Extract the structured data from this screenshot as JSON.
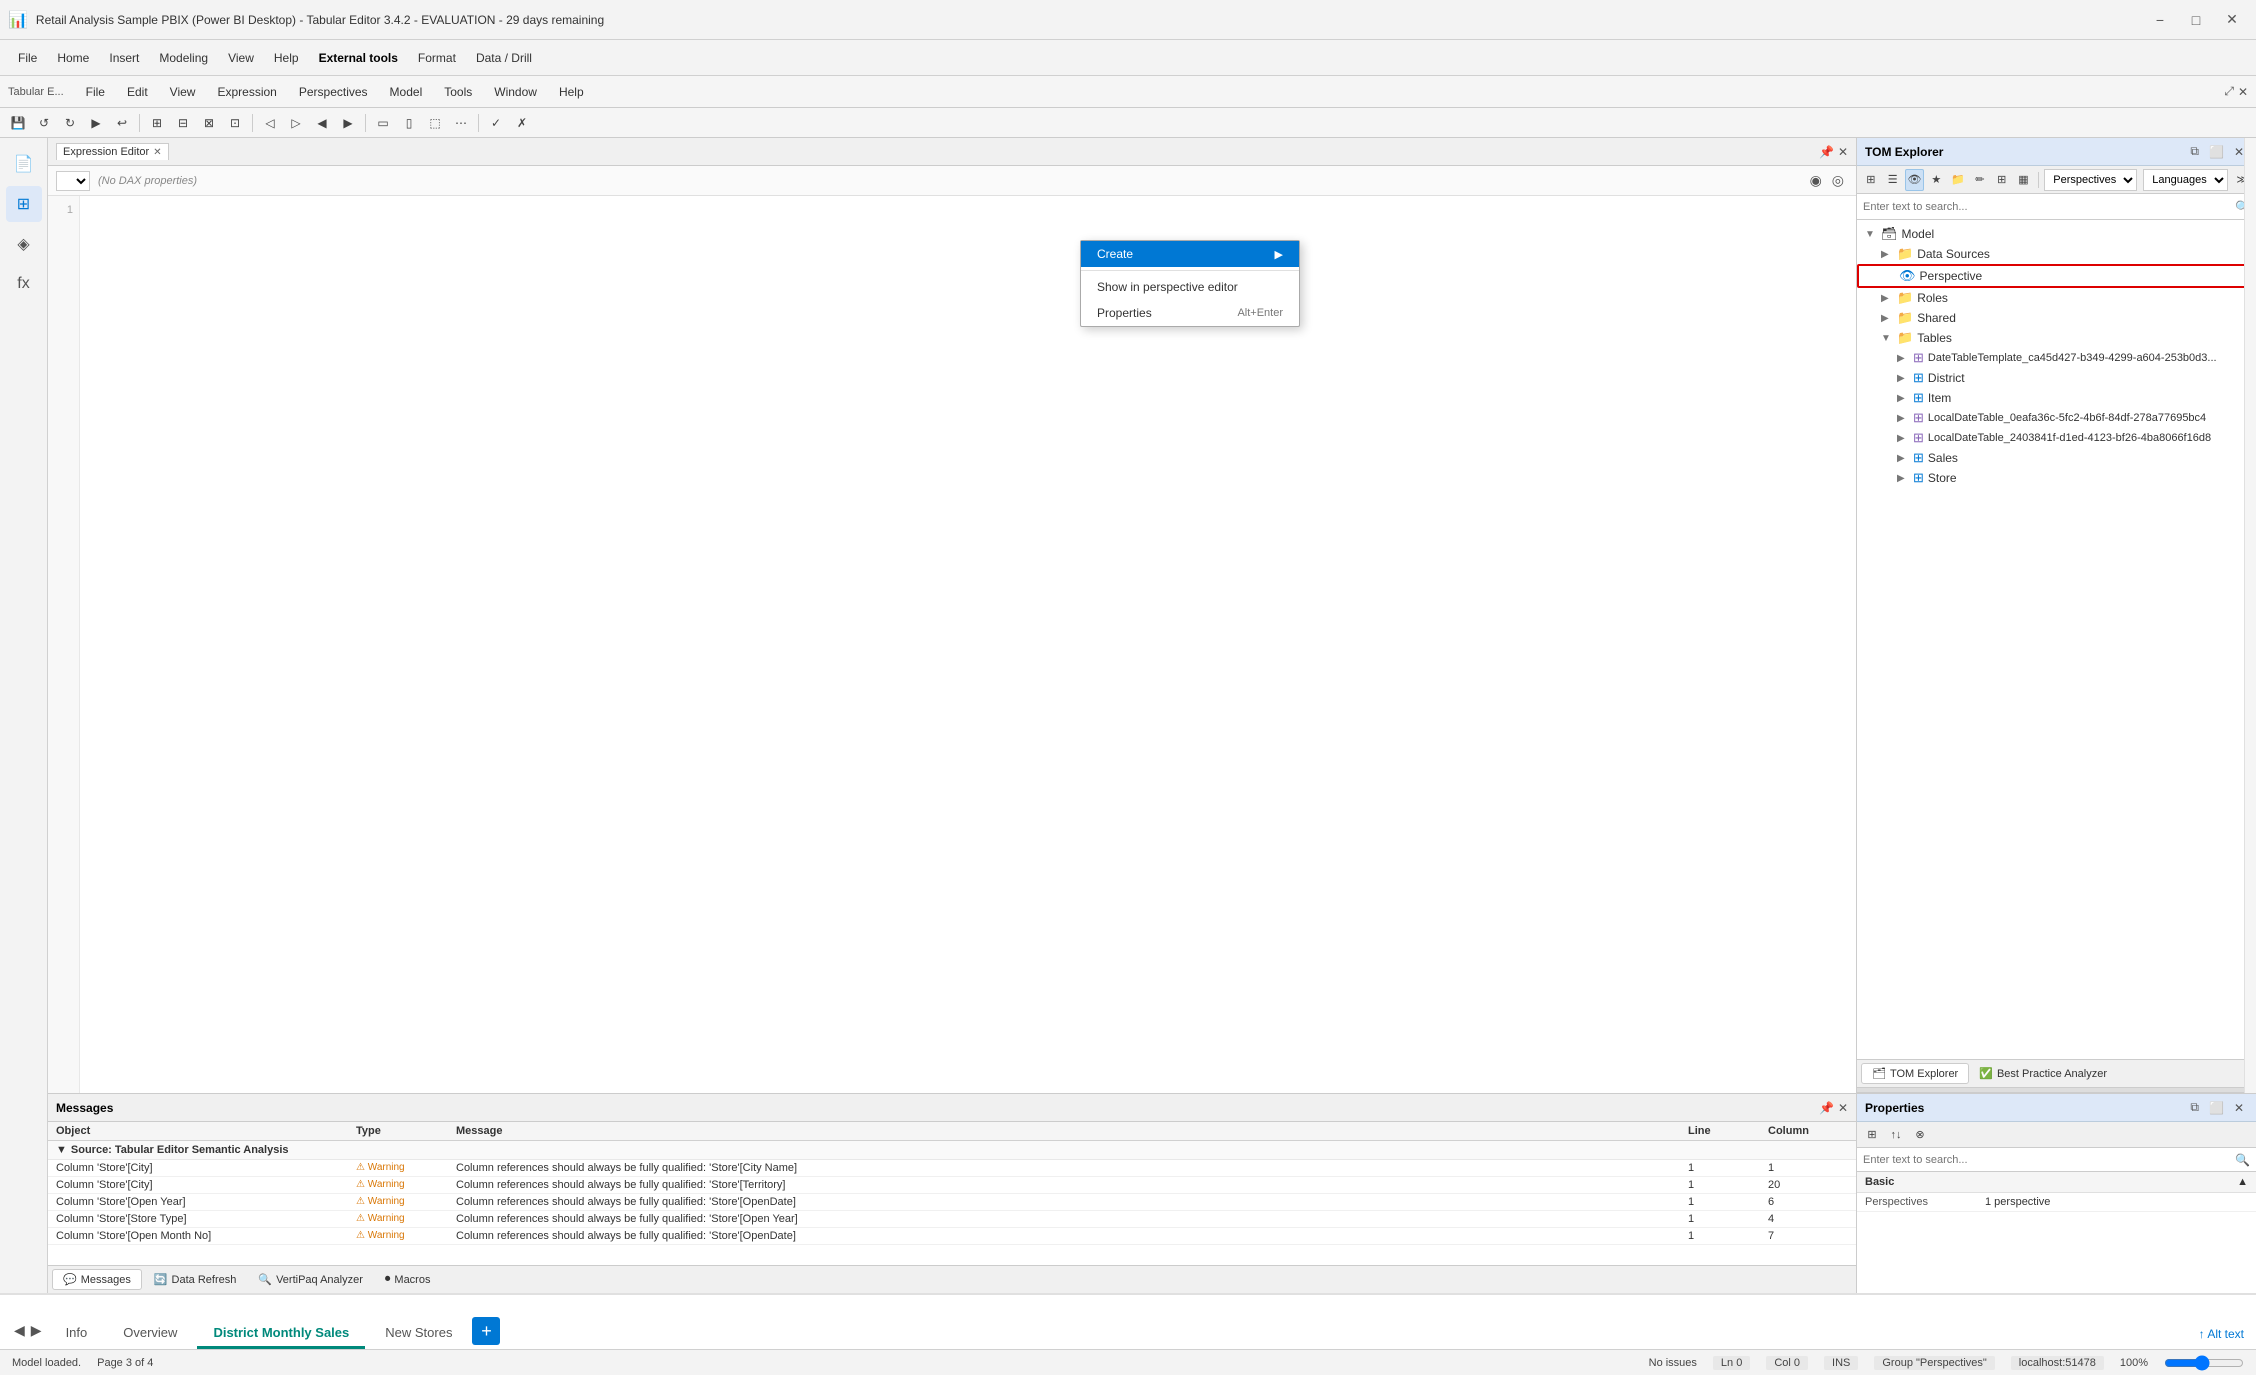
{
  "app": {
    "title": "Retail Analysis Sample PBIX (Power BI Desktop) - Tabular Editor 3.4.2 - EVALUATION - 29 days remaining",
    "icon": "📊"
  },
  "pbi_menu": {
    "items": [
      "File",
      "Home",
      "Insert",
      "Modeling",
      "View",
      "Help",
      "External tools",
      "Format",
      "Data / Drill"
    ]
  },
  "te_menu": {
    "items": [
      "File",
      "Edit",
      "View",
      "Expression",
      "Perspectives",
      "Model",
      "Tools",
      "Window",
      "Help"
    ]
  },
  "expression_editor": {
    "tab_label": "Expression Editor",
    "dax_selector_placeholder": "(No DAX properties)",
    "dax_dropdown_label": ""
  },
  "tom_explorer": {
    "title": "TOM Explorer",
    "search_placeholder": "Enter text to search...",
    "dropdown1": "Perspectives",
    "dropdown2": "Languages",
    "tree": {
      "model_label": "Model",
      "items": [
        {
          "level": 1,
          "label": "Data Sources",
          "icon": "folder",
          "expanded": false
        },
        {
          "level": 1,
          "label": "Roles",
          "icon": "folder",
          "expanded": false
        },
        {
          "level": 1,
          "label": "Shared",
          "icon": "folder",
          "expanded": false
        },
        {
          "level": 1,
          "label": "Tables",
          "icon": "folder",
          "expanded": true,
          "children": [
            {
              "label": "DateTableTemplate_ca45d427-b349-4299-a604-253b0d3...",
              "icon": "table-special"
            },
            {
              "label": "District",
              "icon": "table"
            },
            {
              "label": "Item",
              "icon": "table"
            },
            {
              "label": "LocalDateTable_0eafa36c-5fc2-4b6f-84df-278a77695bc4",
              "icon": "table-special"
            },
            {
              "label": "LocalDateTable_2403841f-d1ed-4123-bf26-4ba8066f16d8",
              "icon": "table-special"
            },
            {
              "label": "Sales",
              "icon": "table"
            },
            {
              "label": "Store",
              "icon": "table"
            }
          ]
        }
      ]
    },
    "tabs": [
      {
        "label": "TOM Explorer",
        "icon": "🗂"
      },
      {
        "label": "Best Practice Analyzer",
        "icon": "✓"
      }
    ]
  },
  "properties": {
    "title": "Properties",
    "search_placeholder": "Enter text to search...",
    "sections": [
      {
        "label": "Basic",
        "rows": [
          {
            "label": "Perspectives",
            "value": "1 perspective"
          }
        ]
      }
    ]
  },
  "messages": {
    "title": "Messages",
    "columns": [
      "Object",
      "Type",
      "Message",
      "Line",
      "Column"
    ],
    "group_label": "Source: Tabular Editor Semantic Analysis",
    "rows": [
      {
        "object": "Column 'Store'[City]",
        "type": "Warning",
        "message": "Column references should always be fully qualified: 'Store'[City Name]",
        "line": "1",
        "col": "1"
      },
      {
        "object": "Column 'Store'[City]",
        "type": "Warning",
        "message": "Column references should always be fully qualified: 'Store'[Territory]",
        "line": "1",
        "col": "20"
      },
      {
        "object": "Column 'Store'[Open Year]",
        "type": "Warning",
        "message": "Column references should always be fully qualified: 'Store'[OpenDate]",
        "line": "1",
        "col": "6"
      },
      {
        "object": "Column 'Store'[Store Type]",
        "type": "Warning",
        "message": "Column references should always be fully qualified: 'Store'[Open Year]",
        "line": "1",
        "col": "4"
      },
      {
        "object": "Column 'Store'[Open Month No]",
        "type": "Warning",
        "message": "Column references should always be fully qualified: 'Store'[OpenDate]",
        "line": "1",
        "col": "7"
      }
    ]
  },
  "bottom_tabs": {
    "nav_prev": "◀",
    "nav_next": "▶",
    "tabs": [
      "Info",
      "Overview",
      "District Monthly Sales",
      "New Stores"
    ],
    "active_tab": "District Monthly Sales",
    "add_label": "+",
    "alt_text": "↑ Alt text"
  },
  "status_bar": {
    "left": "Model loaded.",
    "issues": "No issues",
    "ln": "Ln 0",
    "col": "Col 0",
    "ins": "INS",
    "group": "Group \"Perspectives\"",
    "server": "localhost:51478",
    "page": "Page 3 of 4",
    "zoom": "100%"
  },
  "context_menu": {
    "items": [
      {
        "label": "Create",
        "has_submenu": true,
        "highlighted": true
      },
      {
        "label": "Show in perspective editor"
      },
      {
        "label": "Properties",
        "shortcut": "Alt+Enter"
      }
    ]
  },
  "perspective_item": {
    "label": "Perspective",
    "icon": "👁"
  }
}
